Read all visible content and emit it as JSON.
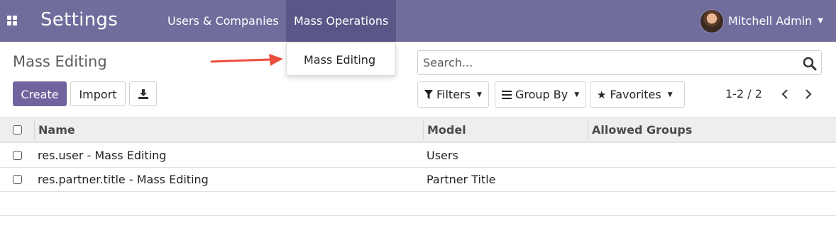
{
  "navbar": {
    "brand": "Settings",
    "menu": [
      {
        "label": "Users & Companies"
      },
      {
        "label": "Mass Operations"
      }
    ],
    "user_name": "Mitchell Admin"
  },
  "dropdown": {
    "items": [
      {
        "label": "Mass Editing"
      }
    ]
  },
  "control_panel": {
    "title": "Mass Editing",
    "create_label": "Create",
    "import_label": "Import",
    "search_placeholder": "Search...",
    "filters_label": "Filters",
    "group_by_label": "Group By",
    "favorites_label": "Favorites",
    "pager": "1-2 / 2"
  },
  "table": {
    "headers": [
      "Name",
      "Model",
      "Allowed Groups"
    ],
    "rows": [
      {
        "name": "res.user - Mass Editing",
        "model": "Users",
        "groups": ""
      },
      {
        "name": "res.partner.title - Mass Editing",
        "model": "Partner Title",
        "groups": ""
      }
    ]
  },
  "colors": {
    "navbar": "#706c9c",
    "active_menu": "#5a5687",
    "primary_button": "#71639e",
    "annotation_arrow": "#ea4e3c"
  }
}
